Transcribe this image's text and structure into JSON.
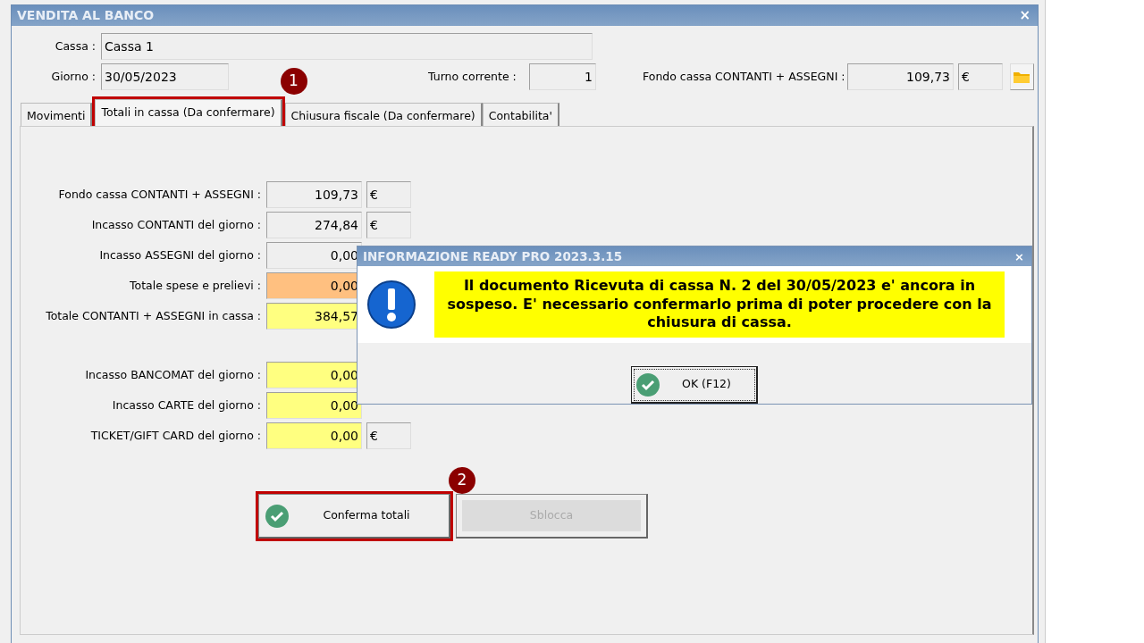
{
  "window": {
    "title": "VENDITA AL BANCO",
    "close": "×"
  },
  "header": {
    "cassa": {
      "label": "Cassa :",
      "value": "Cassa 1"
    },
    "giorno": {
      "label": "Giorno :",
      "value": "30/05/2023"
    },
    "turno": {
      "label": "Turno corrente :",
      "value": "1"
    },
    "fondo": {
      "label": "Fondo cassa CONTANTI + ASSEGNI :",
      "value": "109,73",
      "currency": "€"
    }
  },
  "tabs": [
    {
      "label": "Movimenti",
      "selected": false
    },
    {
      "label": "Totali in cassa (Da confermare)",
      "selected": true,
      "callout": "1"
    },
    {
      "label": "Chiusura fiscale (Da confermare)",
      "selected": false
    },
    {
      "label": "Contabilita'",
      "selected": false
    }
  ],
  "totals": [
    {
      "label": "Fondo cassa CONTANTI + ASSEGNI :",
      "value": "109,73",
      "currency": "€",
      "color": "#efefef"
    },
    {
      "label": "Incasso CONTANTI del giorno :",
      "value": "274,84",
      "currency": "€",
      "color": "#efefef"
    },
    {
      "label": "Incasso ASSEGNI del giorno :",
      "value": "0,00",
      "color": "#efefef"
    },
    {
      "label": "Totale spese e prelievi :",
      "value": "0,00",
      "color": "#ffc080"
    },
    {
      "label": "Totale CONTANTI + ASSEGNI in cassa :",
      "value": "384,57",
      "color": "#ffff80"
    }
  ],
  "card_totals": [
    {
      "label": "Incasso BANCOMAT del giorno :",
      "value": "0,00",
      "color": "#ffff80"
    },
    {
      "label": "Incasso CARTE del giorno :",
      "value": "0,00",
      "color": "#ffff80"
    },
    {
      "label": "TICKET/GIFT CARD del giorno :",
      "value": "0,00",
      "currency": "€",
      "color": "#ffff80"
    }
  ],
  "buttons": [
    {
      "label": "Conferma totali",
      "disabled": false,
      "callout": "2"
    },
    {
      "label": "Sblocca",
      "disabled": true
    }
  ],
  "dialog": {
    "title": "INFORMAZIONE READY PRO 2023.3.15",
    "close": "×",
    "message": "Il documento Ricevuta di cassa N. 2 del 30/05/2023 e' ancora in sospeso. E' necessario confermarlo prima di poter procedere con la chiusura di cassa.",
    "button": "OK (F12)"
  }
}
